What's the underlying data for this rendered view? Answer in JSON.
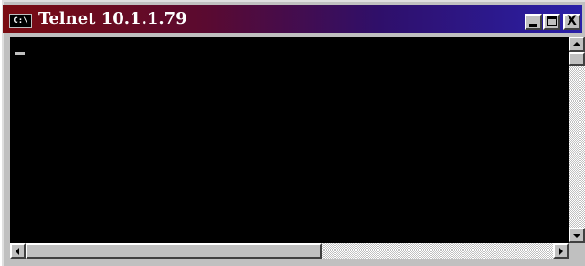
{
  "window": {
    "title": "Telnet 10.1.1.79",
    "icon_label": "C:\\",
    "icon": "console-app-icon"
  },
  "titlebar_buttons": {
    "minimize_icon": "minimize-icon",
    "maximize_icon": "maximize-icon",
    "close_label": "X",
    "close_icon": "close-icon"
  },
  "console": {
    "content": "",
    "background": "#000000",
    "cursor_color": "#c0c0c0"
  },
  "colors": {
    "titlebar_start": "#7a0c12",
    "titlebar_end": "#2a20a8",
    "chrome": "#c0c0c0"
  }
}
